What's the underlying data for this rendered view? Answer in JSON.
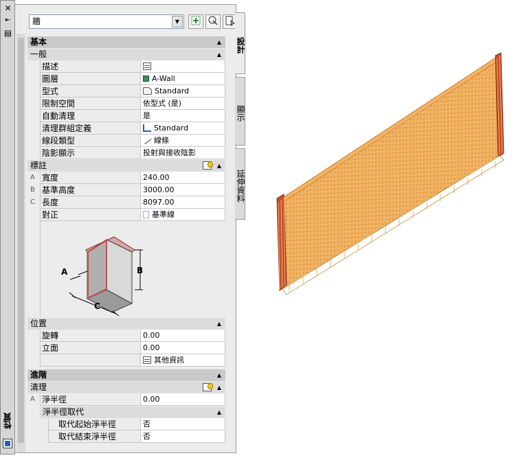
{
  "palette": {
    "title": "性質",
    "object_type": "牆",
    "tabs": [
      "設計",
      "顯示",
      "延伸資料"
    ]
  },
  "sections": {
    "basic": "基本",
    "general": "一般",
    "dimensions": "標註",
    "location": "位置",
    "advanced": "進階",
    "cleanup": "清理",
    "cleanup_override": "淨半徑取代"
  },
  "general_props": [
    {
      "name": "描述",
      "value": "",
      "icon": "table-icon"
    },
    {
      "name": "圖層",
      "value": "A-Wall",
      "icon": "layer-icon"
    },
    {
      "name": "型式",
      "value": "Standard",
      "icon": "style-icon"
    },
    {
      "name": "限制空間",
      "value": "依型式 (是)",
      "icon": ""
    },
    {
      "name": "自動清理",
      "value": "是",
      "icon": ""
    },
    {
      "name": "清理群組定義",
      "value": "Standard",
      "icon": "cleanup-icon"
    },
    {
      "name": "線段類型",
      "value": "線條",
      "icon": "line-icon"
    },
    {
      "name": "陰影顯示",
      "value": "投射與接收陰影",
      "icon": ""
    }
  ],
  "dimension_props": [
    {
      "marker": "A",
      "name": "寬度",
      "value": "240.00"
    },
    {
      "marker": "B",
      "name": "基準高度",
      "value": "3000.00"
    },
    {
      "marker": "C",
      "name": "長度",
      "value": "8097.00"
    },
    {
      "marker": "",
      "name": "對正",
      "value": "基準線"
    }
  ],
  "diagram_labels": {
    "a": "A",
    "b": "B",
    "c": "C"
  },
  "location_props": [
    {
      "name": "旋轉",
      "value": "0.00"
    },
    {
      "name": "立面",
      "value": "0.00"
    },
    {
      "name": "",
      "value": "其他資訊"
    }
  ],
  "cleanup_props": [
    {
      "marker": "A",
      "name": "淨半徑",
      "value": "0.00"
    }
  ],
  "override_props": [
    {
      "name": "取代起始淨半徑",
      "value": "否"
    },
    {
      "name": "取代結束淨半徑",
      "value": "否"
    }
  ],
  "colors": {
    "brick": "#e8902a",
    "mortar": "#f6d08a",
    "layer_swatch": "#3c8f5e"
  }
}
